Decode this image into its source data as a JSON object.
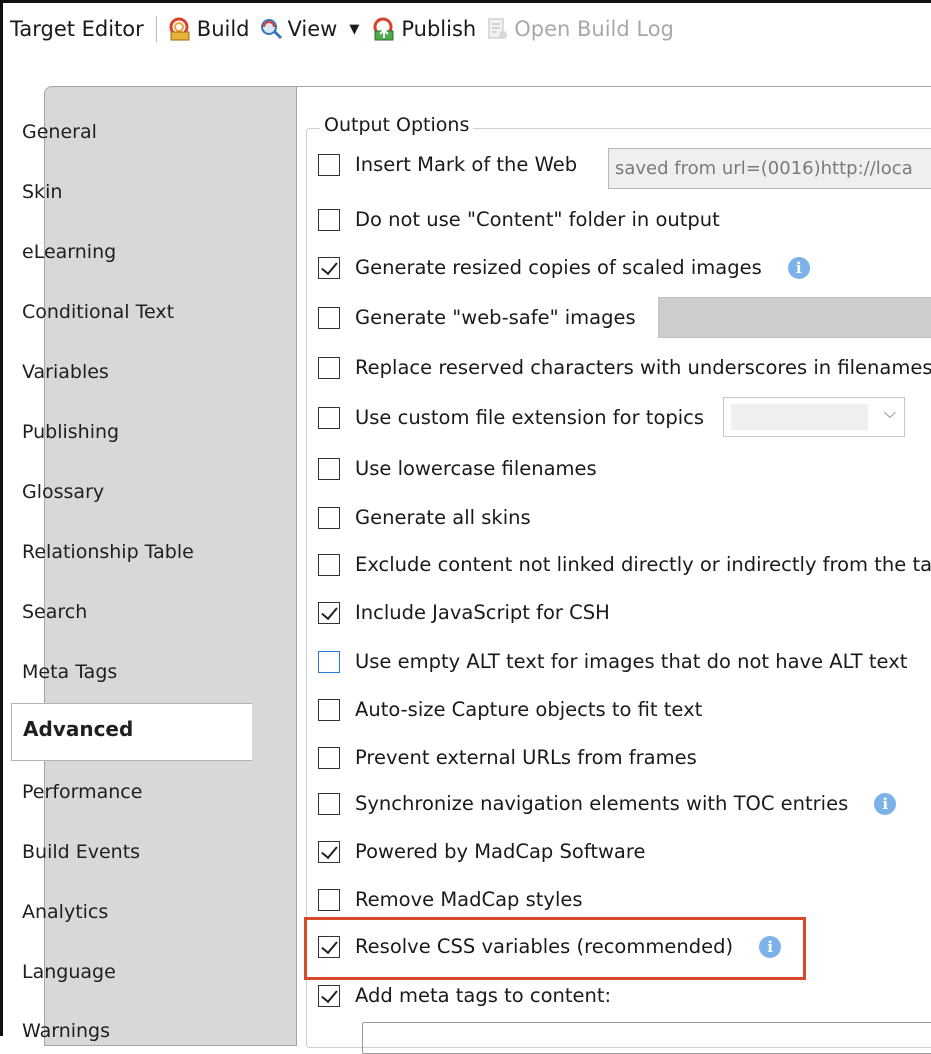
{
  "toolbar": {
    "title": "Target Editor",
    "build_label": "Build",
    "view_label": "View",
    "publish_label": "Publish",
    "open_build_log_label": "Open Build Log"
  },
  "tabs": [
    "General",
    "Skin",
    "eLearning",
    "Conditional Text",
    "Variables",
    "Publishing",
    "Glossary",
    "Relationship Table",
    "Search",
    "Meta Tags",
    "Advanced",
    "Performance",
    "Build Events",
    "Analytics",
    "Language",
    "Warnings"
  ],
  "active_tab": "Advanced",
  "output_options": {
    "legend": "Output Options",
    "mark_of_web_value": "saved from url=(0016)http://loca",
    "items": [
      {
        "label": "Insert Mark of the Web",
        "checked": false
      },
      {
        "label": "Do not use \"Content\" folder in output",
        "checked": false
      },
      {
        "label": "Generate resized copies of scaled images",
        "checked": true
      },
      {
        "label": "Generate \"web-safe\" images",
        "checked": false
      },
      {
        "label": "Replace reserved characters with underscores in filenames",
        "checked": false
      },
      {
        "label": "Use custom file extension for topics",
        "checked": false
      },
      {
        "label": "Use lowercase filenames",
        "checked": false
      },
      {
        "label": "Generate all skins",
        "checked": false
      },
      {
        "label": "Exclude content not linked directly or indirectly from the targ",
        "checked": false
      },
      {
        "label": "Include JavaScript for CSH",
        "checked": true
      },
      {
        "label": "Use empty ALT text for images that do not have ALT text",
        "checked": false
      },
      {
        "label": "Auto-size Capture objects to fit text",
        "checked": false
      },
      {
        "label": "Prevent external URLs from frames",
        "checked": false
      },
      {
        "label": "Synchronize navigation elements with TOC entries",
        "checked": false
      },
      {
        "label": "Powered by MadCap Software",
        "checked": true
      },
      {
        "label": "Remove MadCap styles",
        "checked": false
      },
      {
        "label": "Resolve CSS variables (recommended)",
        "checked": true
      },
      {
        "label": "Add meta tags to content:",
        "checked": true
      }
    ]
  },
  "colors": {
    "highlight": "#d6492a",
    "info": "#7db2e8",
    "tab_strip": "#d8d8d8"
  }
}
